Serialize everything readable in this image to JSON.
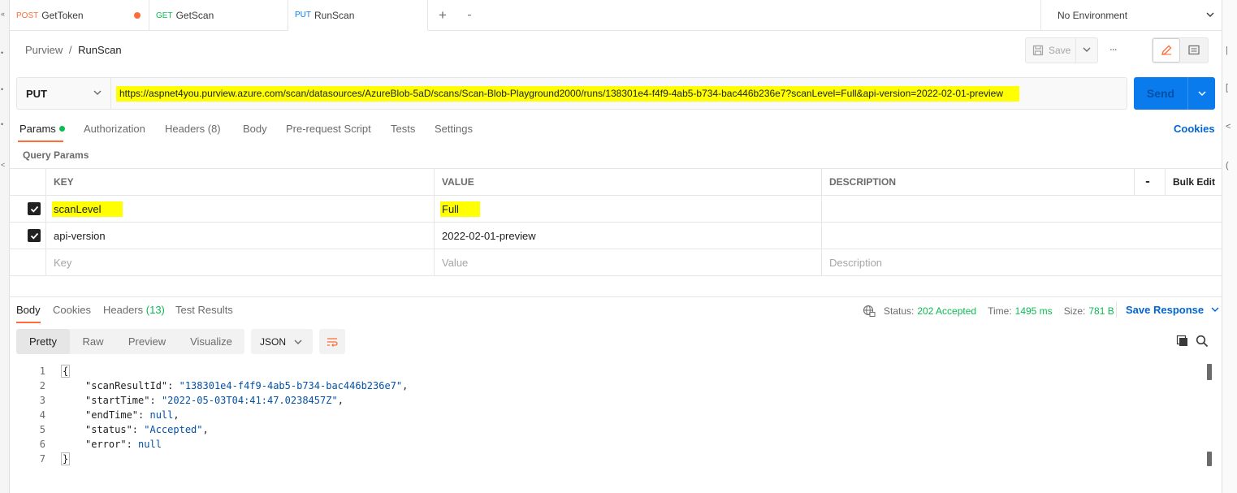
{
  "left_strip_glyphs": [
    "«",
    "•",
    "•",
    "•",
    "<"
  ],
  "right_strip_glyphs": [
    "|",
    "[",
    "<",
    "("
  ],
  "tabs": [
    {
      "method": "POST",
      "name": "GetToken",
      "method_color": "#ff6c37",
      "unsaved": true
    },
    {
      "method": "GET",
      "name": "GetScan",
      "method_color": "#0cbb52",
      "unsaved": false
    },
    {
      "method": "PUT",
      "name": "RunScan",
      "method_color": "#097bed",
      "unsaved": false,
      "active": true
    }
  ],
  "tab_actions": {
    "new": "+",
    "more": "∙∙∙"
  },
  "environment": {
    "label": "No Environment"
  },
  "breadcrumb": {
    "collection": "Purview",
    "separator": "/",
    "request": "RunScan"
  },
  "toolbar": {
    "save_label": "Save",
    "more": "∙∙∙"
  },
  "request": {
    "method": "PUT",
    "url": "https://aspnet4you.purview.azure.com/scan/datasources/AzureBlob-5aD/scans/Scan-Blob-Playground2000/runs/138301e4-f4f9-4ab5-b734-bac446b236e7?scanLevel=Full&api-version=2022-02-01-preview",
    "send_label": "Send"
  },
  "request_tabs": {
    "params": "Params",
    "authorization": "Authorization",
    "headers": "Headers (8)",
    "body": "Body",
    "prerequest": "Pre-request Script",
    "tests": "Tests",
    "settings": "Settings",
    "cookies": "Cookies"
  },
  "query_params": {
    "title": "Query Params",
    "headers": {
      "key": "KEY",
      "value": "VALUE",
      "description": "DESCRIPTION",
      "more": "∙∙∙",
      "bulk_edit": "Bulk Edit"
    },
    "rows": [
      {
        "key": "scanLevel",
        "value": "Full",
        "description": "",
        "checked": true
      },
      {
        "key": "api-version",
        "value": "2022-02-01-preview",
        "description": "",
        "checked": true
      }
    ],
    "placeholders": {
      "key": "Key",
      "value": "Value",
      "description": "Description"
    }
  },
  "response": {
    "tabs": {
      "body": "Body",
      "cookies": "Cookies",
      "headers_label": "Headers",
      "headers_count": "(13)",
      "test_results": "Test Results"
    },
    "status_label": "Status:",
    "status_value": "202 Accepted",
    "time_label": "Time:",
    "time_value": "1495 ms",
    "size_label": "Size:",
    "size_value": "781 B",
    "save_response": "Save Response",
    "view_modes": [
      "Pretty",
      "Raw",
      "Preview",
      "Visualize"
    ],
    "active_view": "Pretty",
    "format": "JSON",
    "body_lines": {
      "numbers": [
        "1",
        "2",
        "3",
        "4",
        "5",
        "6",
        "7"
      ],
      "open": "{",
      "close": "}",
      "fields": [
        {
          "key": "\"scanResultId\"",
          "value": "\"138301e4-f4f9-4ab5-b734-bac446b236e7\"",
          "comma": ","
        },
        {
          "key": "\"startTime\"",
          "value": "\"2022-05-03T04:41:47.0238457Z\"",
          "comma": ","
        },
        {
          "key": "\"endTime\"",
          "value": "null",
          "comma": ","
        },
        {
          "key": "\"status\"",
          "value": "\"Accepted\"",
          "comma": ","
        },
        {
          "key": "\"error\"",
          "value": "null",
          "comma": ""
        }
      ]
    }
  },
  "colors": {
    "accent_orange": "#ff6c37",
    "send_blue": "#097bed",
    "link_blue": "#0265d2",
    "success_green": "#0cbb52",
    "highlight_yellow": "#ffff00"
  }
}
